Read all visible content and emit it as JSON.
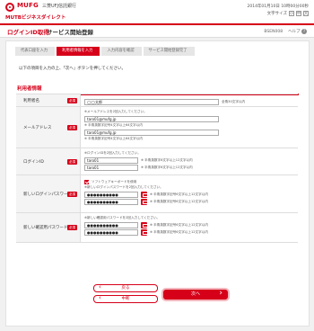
{
  "header": {
    "brand": "MUFG",
    "bank": "三菱UFJ信託銀行",
    "service": "MUTBビジネスダイレクト",
    "datetime": "2014年01月10日 10時00分00秒",
    "font_size_label": "文字サイズ",
    "font_small": "小",
    "font_medium": "中",
    "font_large": "大"
  },
  "titlebar": {
    "login_title": "ログインID取得",
    "page_title": "サービス開始登録",
    "help_code": "BSEN008",
    "help_label": "ヘルプ"
  },
  "steps": [
    "代表口座を入力",
    "利用者情報を入力",
    "入力内容を確認",
    "サービス開始登録完了"
  ],
  "intro": "以下の項目を入力の上、「次へ」ボタンを押してください。",
  "section_title": "利用者情報",
  "required_label": "必須",
  "form": {
    "name_label": "利用者名",
    "name_value": "◯◯太郎",
    "name_note": "全角30文字以内",
    "email_label": "メールアドレス",
    "email_note1": "※メールアドレスを2回入力してください。",
    "email_value1": "taro01@mufg.jp",
    "email_note2": "※ 半角英数字記号4文字以上64文字以内",
    "email_value2": "taro01@mufg.jp",
    "email_note3": "※ 半角英数字記号4文字以上64文字以内",
    "login_label": "ログインID",
    "login_note1": "※ログインIDを2回入力してください。",
    "login_value1": "taro01",
    "login_note2": "※ 半角英数字6文字以上12文字以内",
    "login_value2": "taro01",
    "login_note3": "※ 半角英数字6文字以上12文字以内",
    "swkbd_label": "ソフトウェアキーボードを使用",
    "pw_label": "新しいログインパスワード",
    "pw_note1": "※新しいログインパスワードを2回入力してください。",
    "pw_value1": "●●●●●●●●●●",
    "pw_note2": "※ 半角英数字記号6文字以上12文字以内",
    "pw_value2": "●●●●●●●●●●",
    "pw_note3": "※ 半角英数字記号6文字以上12文字以内",
    "cpw_label": "新しい確認用パスワード",
    "cpw_note1": "※新しい確認用パスワードを2回入力してください。",
    "cpw_value1": "●●●●●●●●●●",
    "cpw_note2": "※ 半角英数字記号6文字以上12文字以内",
    "cpw_value2": "●●●●●●●●●●",
    "cpw_note3": "※ 半角英数字記号6文字以上12文字以内"
  },
  "buttons": {
    "back": "戻る",
    "cancel": "中断",
    "next": "次へ"
  },
  "colors": {
    "brand_red": "#d60019"
  }
}
